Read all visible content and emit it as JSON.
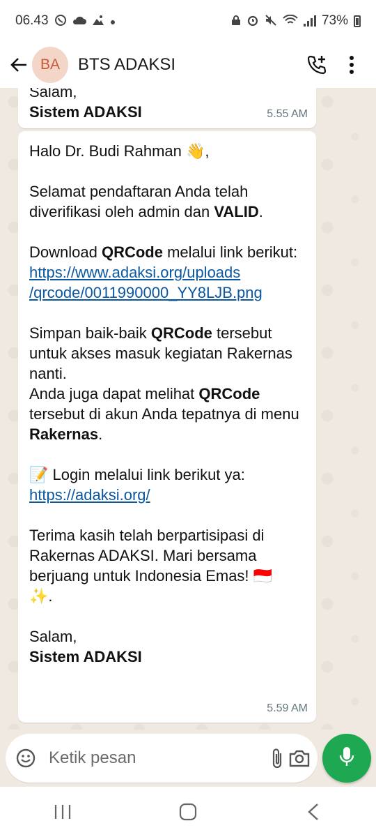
{
  "status_bar": {
    "time": "06.43",
    "battery": "73%",
    "icons": [
      "whatsapp-icon",
      "cloud-icon",
      "photo-icon",
      "dot-icon",
      "lock-icon",
      "alarm-icon",
      "mute-icon",
      "wifi-icon",
      "signal-icon",
      "battery-icon"
    ]
  },
  "header": {
    "avatar_initials": "BA",
    "contact_name": "BTS ADAKSI",
    "icons": [
      "back-arrow-icon",
      "add-call-icon",
      "more-vert-icon"
    ]
  },
  "messages": [
    {
      "partial_top": "Salam,",
      "sender_sign": "Sistem ADAKSI",
      "time": "5.55 AM"
    },
    {
      "greeting": "Halo Dr. Budi Rahman",
      "greeting_emoji": "👋",
      "greeting_suffix": ",",
      "p1_a": "Selamat pendaftaran Anda telah diverifikasi oleh admin dan ",
      "p1_bold": "VALID",
      "p1_b": ".",
      "p2_a": "Download ",
      "p2_bold": "QRCode",
      "p2_b": " melalui link berikut:",
      "link1_line1": "https://www.adaksi.org/uploads",
      "link1_line2": "/qrcode/0011990000_YY8LJB.png",
      "p3_a": "Simpan baik-baik ",
      "p3_bold": "QRCode",
      "p3_b": " tersebut untuk akses masuk kegiatan Rakernas nanti.",
      "p4_a": "Anda juga dapat melihat ",
      "p4_bold": "QRCode",
      "p4_b": " tersebut di akun Anda tepatnya di menu ",
      "p4_bold2": "Rakernas",
      "p4_c": ".",
      "login_emoji": "📝",
      "login_text": " Login melalui link berikut ya:",
      "link2": "https://adaksi.org/",
      "p5": "Terima kasih telah berpartisipasi di Rakernas ADAKSI. Mari bersama berjuang untuk Indonesia Emas! ",
      "p5_flag": "🇮🇩",
      "p5_sparkle": "✨",
      "p5_end": ".",
      "closing": "Salam,",
      "sender_sign": "Sistem ADAKSI",
      "time": "5.59 AM"
    }
  ],
  "composer": {
    "placeholder": "Ketik pesan",
    "icons": [
      "emoji-icon",
      "attach-icon",
      "camera-icon",
      "mic-icon"
    ]
  },
  "nav_bar": {
    "icons": [
      "recents-icon",
      "home-icon",
      "back-icon"
    ]
  },
  "colors": {
    "accent_green": "#1da851",
    "link": "#0b57a0",
    "chat_bg": "#efe9e1",
    "avatar_bg": "#f3d6c8",
    "avatar_text": "#c75a3a"
  }
}
